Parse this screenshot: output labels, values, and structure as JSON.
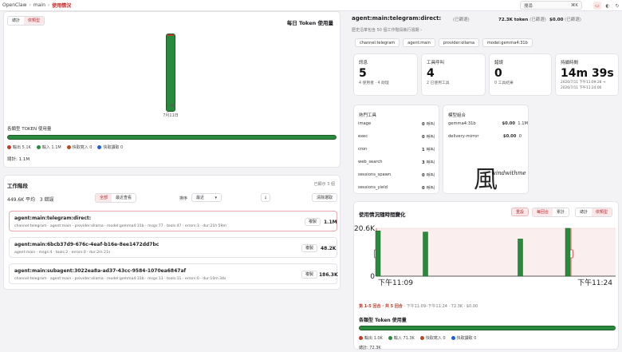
{
  "topbar": {
    "breadcrumb": [
      "OpenClaw",
      "main",
      "使用情況"
    ],
    "search_placeholder": "搜尋",
    "search_shortcut": "⌘K"
  },
  "left": {
    "tabs": [
      "總計",
      "依類型"
    ],
    "selected_tab": "依類型",
    "daily_title": "每日 Token 使用量",
    "daily_bar_label": "1.3M",
    "daily_bar_date": "7月11日",
    "category_title": "各類型 TOKEN 使用量",
    "legend": [
      {
        "label": "輸出 5.1K",
        "color": "#c0392b"
      },
      {
        "label": "輸入 1.1M",
        "color": "#2a8a3c"
      },
      {
        "label": "快取寫入 0",
        "color": "#b94a1f"
      },
      {
        "label": "快取讀取 0",
        "color": "#1f5fd6"
      }
    ],
    "total": "總計: 1.1M"
  },
  "sessions": {
    "title": "工作階段",
    "shown": "已顯示 3 個",
    "avg": "449.6K 平均",
    "errors": "3 錯誤",
    "filter_all": "全部",
    "filter_recent": "最近查看",
    "sort_label": "排序",
    "sort_value": "最近",
    "sort_dir": "↓",
    "clear": "清除選取",
    "items": [
      {
        "name": "agent:main:telegram:direct:",
        "meta": "channel:telegram · agent:main · provider:ollama · model:gemma4:31b · msgs:77 · tools:47 · errors:3 · dur:21h 59m",
        "copy": "複製",
        "tokens": "1.1M"
      },
      {
        "name": "agent:main:6bcb37d9-676c-4eaf-b16e-8ee1472dd7bc",
        "meta": "agent:main · msgs:4 · tools:2 · errors:0 · dur:2m 21s",
        "copy": "複製",
        "tokens": "48.2K"
      },
      {
        "name": "agent:main:subagent:3022ea8a-ad37-43cc-9584-1070ea6847af",
        "meta": "channel:telegram · agent:main · provider:ollama · model:gemma4:31b · msgs:13 · tools:11 · errors:0 · dur:10m 34s",
        "copy": "複製",
        "tokens": "186.3K"
      }
    ]
  },
  "detail": {
    "title": "agent:main:telegram:direct:",
    "selected": "(已篩選)",
    "tokens": "72.3K token",
    "tokens_note": "(已篩選)",
    "cost": "$0.00",
    "cost_note": "(已篩選)",
    "history_note": "歷史沿革包含 50 個工作階段執行週期 ›",
    "tags": [
      "channel:telegram",
      "agent:main",
      "provider:ollama",
      "model:gemma4:31b"
    ]
  },
  "stats": [
    {
      "label": "訊息",
      "value": "5",
      "sub": [
        "4 使用者 · 4 助理"
      ]
    },
    {
      "label": "工具呼叫",
      "value": "4",
      "sub": [
        "2 已使用工具"
      ]
    },
    {
      "label": "錯誤",
      "value": "0",
      "sub": [
        "0 工具結果"
      ]
    },
    {
      "label": "持續時間",
      "value": "14m 39s",
      "sub": [
        "2026/7/11 下午11:09:28 →",
        "2026/7/11 下午11:24:06"
      ]
    }
  ],
  "tools": {
    "title": "熱門工具",
    "unit": "呼叫",
    "items": [
      {
        "name": "image",
        "count": "0"
      },
      {
        "name": "exec",
        "count": "0"
      },
      {
        "name": "cron",
        "count": "1"
      },
      {
        "name": "web_search",
        "count": "3"
      },
      {
        "name": "sessions_spawn",
        "count": "0"
      },
      {
        "name": "sessions_yield",
        "count": "0"
      }
    ]
  },
  "models": {
    "title": "模型組合",
    "items": [
      {
        "name": "gemma4:31b",
        "cost": "$0.00",
        "tokens": "1.1M"
      },
      {
        "name": "delivery-mirror",
        "cost": "$0.00",
        "tokens": "0"
      }
    ],
    "watermark": "windwithme"
  },
  "timeline": {
    "title": "使用情況隨時間變化",
    "reset": "重設",
    "seg1": [
      "每回合",
      "累計"
    ],
    "seg1_sel": "每回合",
    "seg2": [
      "總計",
      "依類型"
    ],
    "seg2_sel": "依類型",
    "footer_highlight": "第 1-5 回合 · 共 5 回合",
    "footer_rest": " · 下午11:09–下午11:24 · 72.3K · $0.00",
    "category_title": "各類型 Token 使用量",
    "legend": [
      {
        "label": "輸出 1.0K",
        "color": "#c0392b"
      },
      {
        "label": "輸入 71.3K",
        "color": "#2a8a3c"
      },
      {
        "label": "快取寫入 0",
        "color": "#b94a1f"
      },
      {
        "label": "快取讀取 0",
        "color": "#1f5fd6"
      }
    ],
    "total": "總計: 72.3K"
  },
  "chart_data": {
    "type": "bar",
    "title": "使用情況隨時間變化",
    "x": [
      1,
      2,
      3,
      4,
      5
    ],
    "values": [
      19500,
      19000,
      0,
      16000,
      20600
    ],
    "ylim": [
      0,
      20600
    ],
    "yticks": [
      "20.6K",
      "0"
    ],
    "xticks": [
      "下午11:09",
      "下午11:24"
    ],
    "color": "#2a8a3c"
  }
}
